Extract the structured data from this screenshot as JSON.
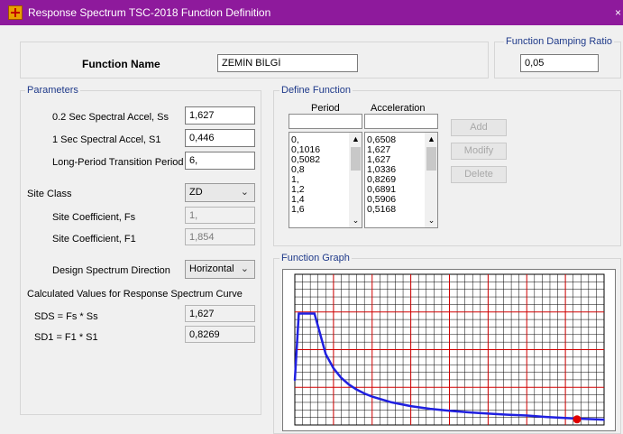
{
  "window": {
    "title": "Response Spectrum TSC-2018 Function Definition",
    "close": "×"
  },
  "function_name": {
    "label": "Function Name",
    "value": "ZEMİN BİLGİ"
  },
  "damping": {
    "group": "Function Damping Ratio",
    "value": "0,05"
  },
  "parameters": {
    "group": "Parameters",
    "ss": {
      "label": "0.2 Sec Spectral Accel, Ss",
      "value": "1,627"
    },
    "s1": {
      "label": "1 Sec Spectral Accel, S1",
      "value": "0,446"
    },
    "tl": {
      "label": "Long-Period Transition Period",
      "value": "6,"
    },
    "site_class": {
      "label": "Site Class",
      "value": "ZD"
    },
    "fs": {
      "label": "Site Coefficient, Fs",
      "value": "1,"
    },
    "f1": {
      "label": "Site Coefficient, F1",
      "value": "1,854"
    },
    "direction": {
      "label": "Design Spectrum Direction",
      "value": "Horizontal"
    },
    "calc_title": "Calculated Values for Response Spectrum Curve",
    "sds": {
      "label": "SDS = Fs * Ss",
      "value": "1,627"
    },
    "sd1": {
      "label": "SD1 = F1 * S1",
      "value": "0,8269"
    }
  },
  "define_function": {
    "group": "Define Function",
    "period_header": "Period",
    "accel_header": "Acceleration",
    "periods": [
      "0,",
      "0,1016",
      "0,5082",
      "0,8",
      "1,",
      "1,2",
      "1,4",
      "1,6"
    ],
    "accels": [
      "0,6508",
      "1,627",
      "1,627",
      "1,0336",
      "0,8269",
      "0,6891",
      "0,5906",
      "0,5168"
    ],
    "add": "Add",
    "modify": "Modify",
    "delete": "Delete"
  },
  "graph": {
    "group": "Function Graph",
    "line_color": "#2020e0",
    "grid_color": "#d00000",
    "marker_color": "#e00000"
  },
  "chart_data": {
    "type": "line",
    "x": [
      0,
      0.1016,
      0.5082,
      0.8,
      1,
      1.2,
      1.4,
      1.6,
      1.8,
      2,
      2.5,
      3,
      3.5,
      4,
      4.5,
      5,
      5.5,
      6,
      6.5,
      7,
      7.5,
      8
    ],
    "y": [
      0.6508,
      1.627,
      1.627,
      1.0336,
      0.8269,
      0.6891,
      0.5906,
      0.5168,
      0.4594,
      0.4135,
      0.3308,
      0.2756,
      0.2363,
      0.2067,
      0.1838,
      0.1654,
      0.1503,
      0.1378,
      0.1174,
      0.1012,
      0.0882,
      0.0775
    ],
    "xlim": [
      0,
      8
    ],
    "ylim": [
      0,
      2.2
    ],
    "grid": true
  }
}
